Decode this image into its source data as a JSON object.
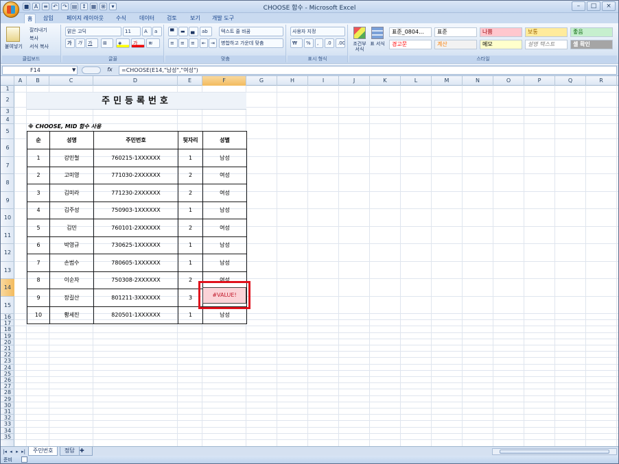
{
  "window": {
    "title": "CHOOSE 함수 - Microsoft Excel",
    "controls": [
      "–",
      "□",
      "×"
    ]
  },
  "ribbon_tabs": [
    "홈",
    "삽입",
    "페이지 레이아웃",
    "수식",
    "데이터",
    "검토",
    "보기",
    "개발 도구"
  ],
  "ribbon": {
    "clipboard": {
      "paste": "붙여넣기",
      "cut": "잘라내기",
      "copy": "복사",
      "format_painter": "서식 복사",
      "label": "클립보드"
    },
    "font": {
      "name": "맑은 고딕",
      "size": "11",
      "label": "글꼴",
      "bold": "가",
      "italic": "가",
      "underline": "가",
      "font_color": "가"
    },
    "alignment": {
      "wrap": "텍스트 줄 바꿈",
      "merge": "병합하고 가운데 맞춤",
      "label": "맞춤"
    },
    "number": {
      "format": "사용자 지정",
      "label": "표시 형식"
    },
    "styles": {
      "conditional": "조건부 서식",
      "table": "표 서식",
      "label": "스타일",
      "cells": [
        {
          "label": "표준_0804...",
          "bg": "#ffffff",
          "fg": "#000000"
        },
        {
          "label": "표준",
          "bg": "#ffffff",
          "fg": "#000000"
        },
        {
          "label": "나쁨",
          "bg": "#ffc7ce",
          "fg": "#9c0006"
        },
        {
          "label": "보통",
          "bg": "#ffeb9c",
          "fg": "#9c6500"
        },
        {
          "label": "좋음",
          "bg": "#c6efce",
          "fg": "#006100"
        },
        {
          "label": "경고문",
          "bg": "#ffffff",
          "fg": "#ff0000"
        },
        {
          "label": "계산",
          "bg": "#f2f2f2",
          "fg": "#fa7d00"
        },
        {
          "label": "메모",
          "bg": "#ffffcc",
          "fg": "#000000"
        },
        {
          "label": "설명 텍스트",
          "bg": "#ffffff",
          "fg": "#7f7f7f"
        },
        {
          "label": "셀 확인",
          "bg": "#a5a5a5",
          "fg": "#ffffff"
        }
      ]
    }
  },
  "formula_bar": {
    "name_box": "F14",
    "fx": "fx",
    "formula": "=CHOOSE(E14,\"남성\",\"여성\")"
  },
  "grid": {
    "columns": [
      "A",
      "B",
      "C",
      "D",
      "E",
      "F",
      "G",
      "H",
      "I",
      "J",
      "K",
      "L",
      "M",
      "N",
      "O",
      "P",
      "Q",
      "R"
    ],
    "selected_column": "F",
    "selected_row": "14",
    "rows": [
      "1",
      "2",
      "3",
      "4",
      "5",
      "6",
      "7",
      "8",
      "9",
      "10",
      "11",
      "12",
      "13",
      "14",
      "15",
      "16",
      "17",
      "18",
      "19",
      "20",
      "21",
      "22",
      "23",
      "24",
      "25",
      "26",
      "27",
      "28",
      "29",
      "30",
      "31",
      "32",
      "33",
      "34",
      "35"
    ]
  },
  "sheet": {
    "title": "주민등록번호",
    "note": "※ CHOOSE, MID 함수 사용",
    "headers": [
      "순",
      "성명",
      "주민번호",
      "뒷자리",
      "성별"
    ],
    "rows": [
      [
        "1",
        "강민철",
        "760215-1XXXXXX",
        "1",
        "남성"
      ],
      [
        "2",
        "고미영",
        "771030-2XXXXXX",
        "2",
        "여성"
      ],
      [
        "3",
        "김미라",
        "771230-2XXXXXX",
        "2",
        "여성"
      ],
      [
        "4",
        "김주성",
        "750903-1XXXXXX",
        "1",
        "남성"
      ],
      [
        "5",
        "김민",
        "760101-2XXXXXX",
        "2",
        "여성"
      ],
      [
        "6",
        "박영규",
        "730625-1XXXXXX",
        "1",
        "남성"
      ],
      [
        "7",
        "손범수",
        "780605-1XXXXXX",
        "1",
        "남성"
      ],
      [
        "8",
        "이순자",
        "750308-2XXXXXX",
        "2",
        "여성"
      ],
      [
        "9",
        "장길산",
        "801211-3XXXXXX",
        "3",
        "#VALUE!"
      ],
      [
        "10",
        "황세진",
        "820501-1XXXXXX",
        "1",
        "남성"
      ]
    ],
    "error_value": "#VALUE!"
  },
  "sheet_tabs": [
    "주민번호",
    "정답"
  ],
  "status": {
    "ready": "준비"
  }
}
